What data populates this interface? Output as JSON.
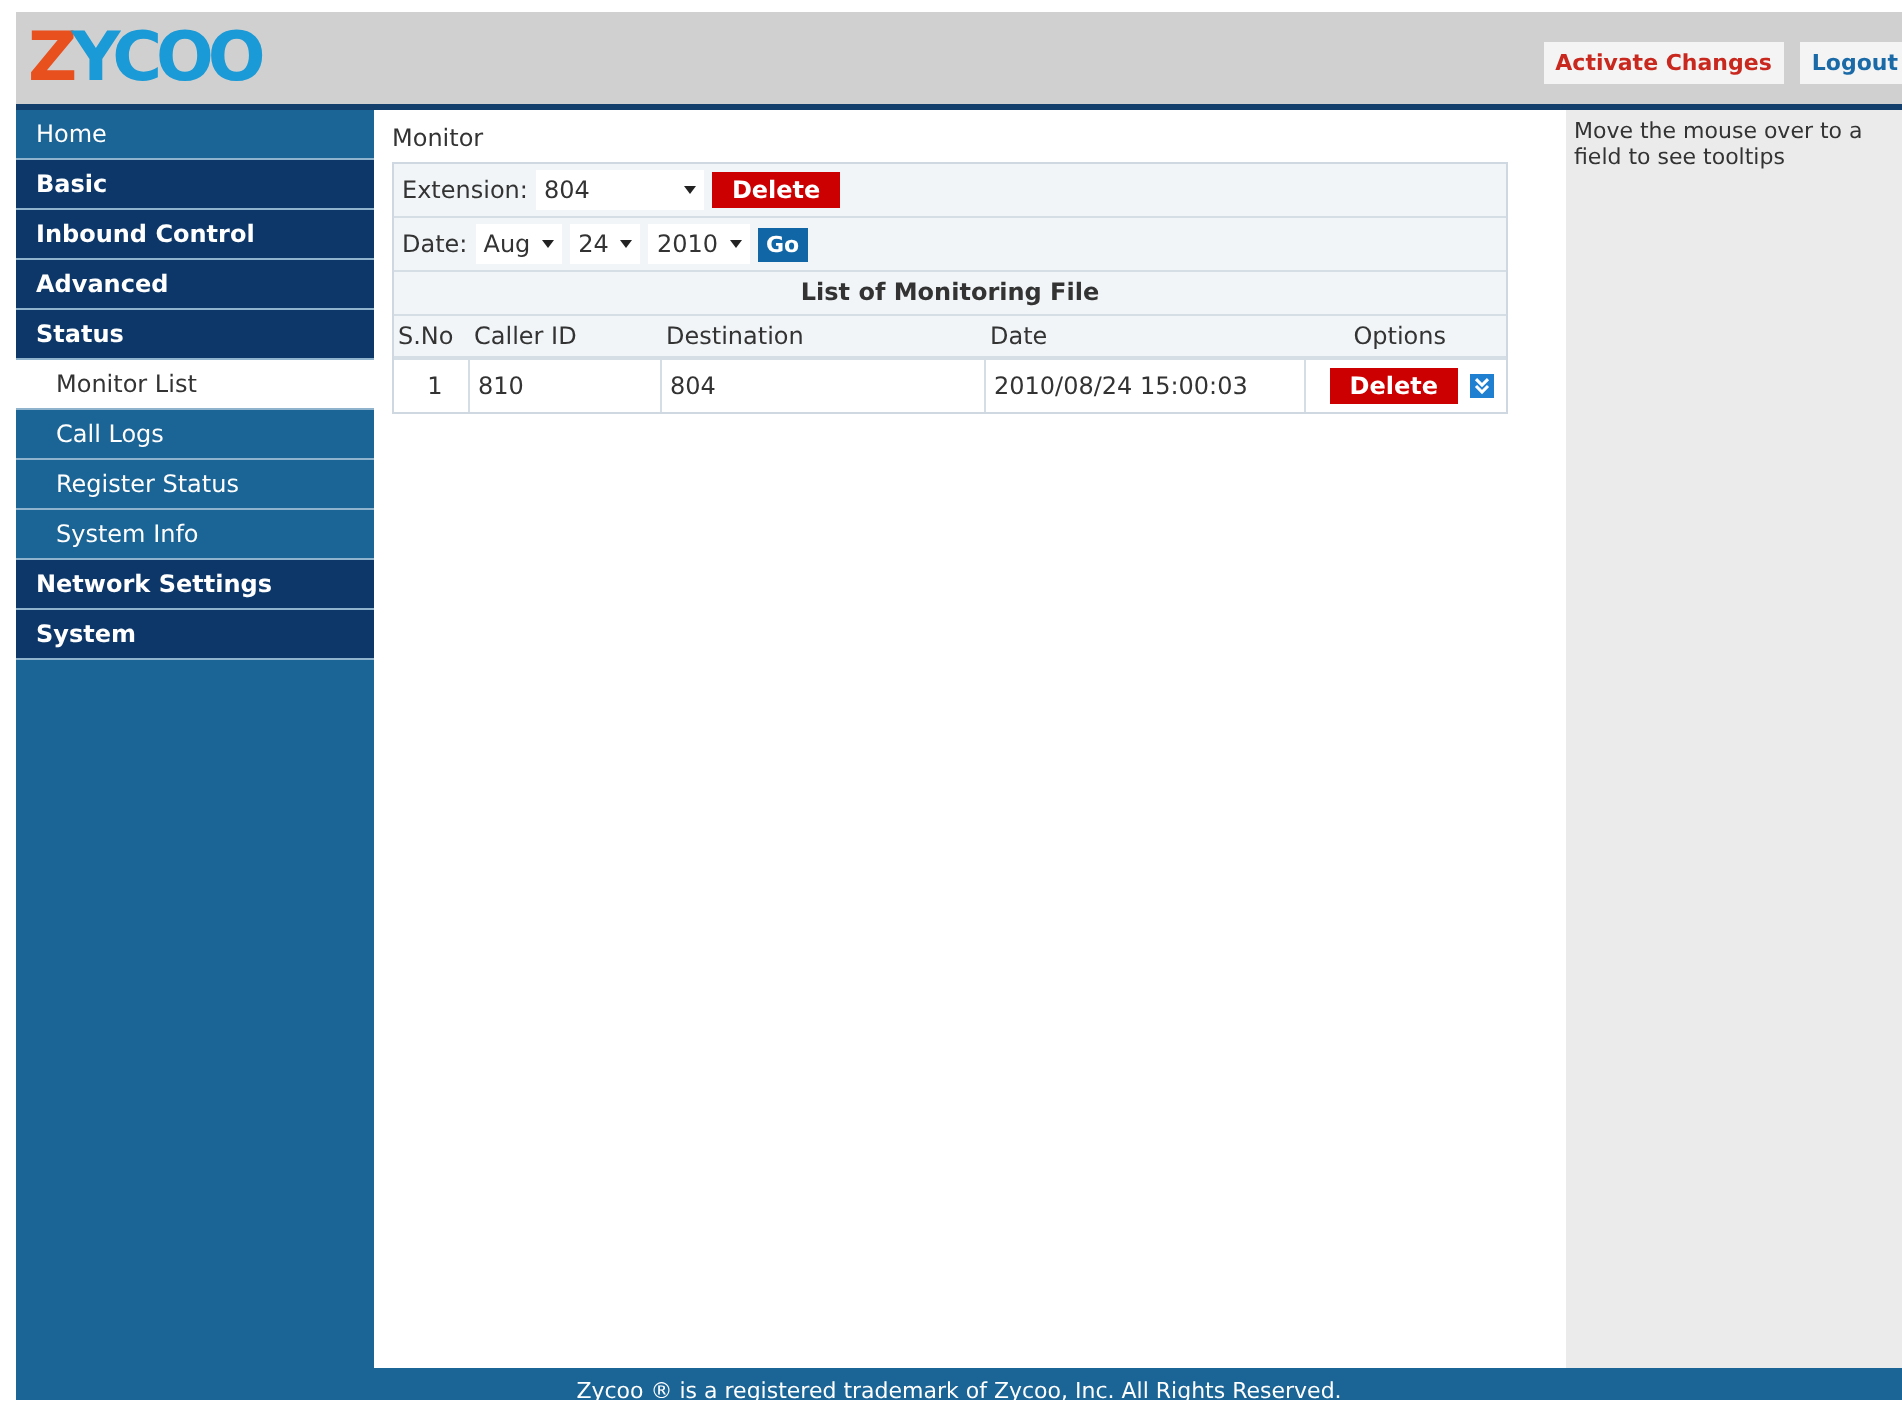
{
  "logo": {
    "parts": [
      {
        "text": "Z",
        "color": "#e8501e"
      },
      {
        "text": "YCOO",
        "color": "#1a9ad6"
      }
    ]
  },
  "header_buttons": [
    {
      "label": "Activate Changes",
      "kind": "activate"
    },
    {
      "label": "Logout",
      "kind": "logout"
    }
  ],
  "sidebar": {
    "items": [
      {
        "label": "Home",
        "kind": "link",
        "selected": false
      },
      {
        "label": "Basic",
        "kind": "section",
        "selected": false
      },
      {
        "label": "Inbound Control",
        "kind": "section",
        "selected": false
      },
      {
        "label": "Advanced",
        "kind": "section",
        "selected": false
      },
      {
        "label": "Status",
        "kind": "section",
        "selected": false
      },
      {
        "label": "Monitor List",
        "kind": "sub",
        "selected": true
      },
      {
        "label": "Call Logs",
        "kind": "sub",
        "selected": false
      },
      {
        "label": "Register Status",
        "kind": "sub",
        "selected": false
      },
      {
        "label": "System Info",
        "kind": "sub",
        "selected": false
      },
      {
        "label": "Network Settings",
        "kind": "section",
        "selected": false
      },
      {
        "label": "System",
        "kind": "section",
        "selected": false
      }
    ]
  },
  "page_title": "Monitor",
  "filters": {
    "extension_label": "Extension:",
    "extension": "804",
    "delete_button": "Delete",
    "date_label": "Date:",
    "month": "Aug",
    "day": "24",
    "year": "2010",
    "go_button": "Go"
  },
  "table": {
    "title": "List of Monitoring File",
    "columns": [
      "S.No",
      "Caller ID",
      "Destination",
      "Date",
      "Options"
    ],
    "rows": [
      {
        "sno": "1",
        "caller_id": "810",
        "destination": "804",
        "date": "2010/08/24 15:00:03",
        "delete_button": "Delete"
      }
    ]
  },
  "tooltip_panel": {
    "text": "Move the mouse over to a field to see tooltips"
  },
  "footer": "Zycoo ® is a registered trademark of Zycoo, Inc. All Rights Reserved."
}
